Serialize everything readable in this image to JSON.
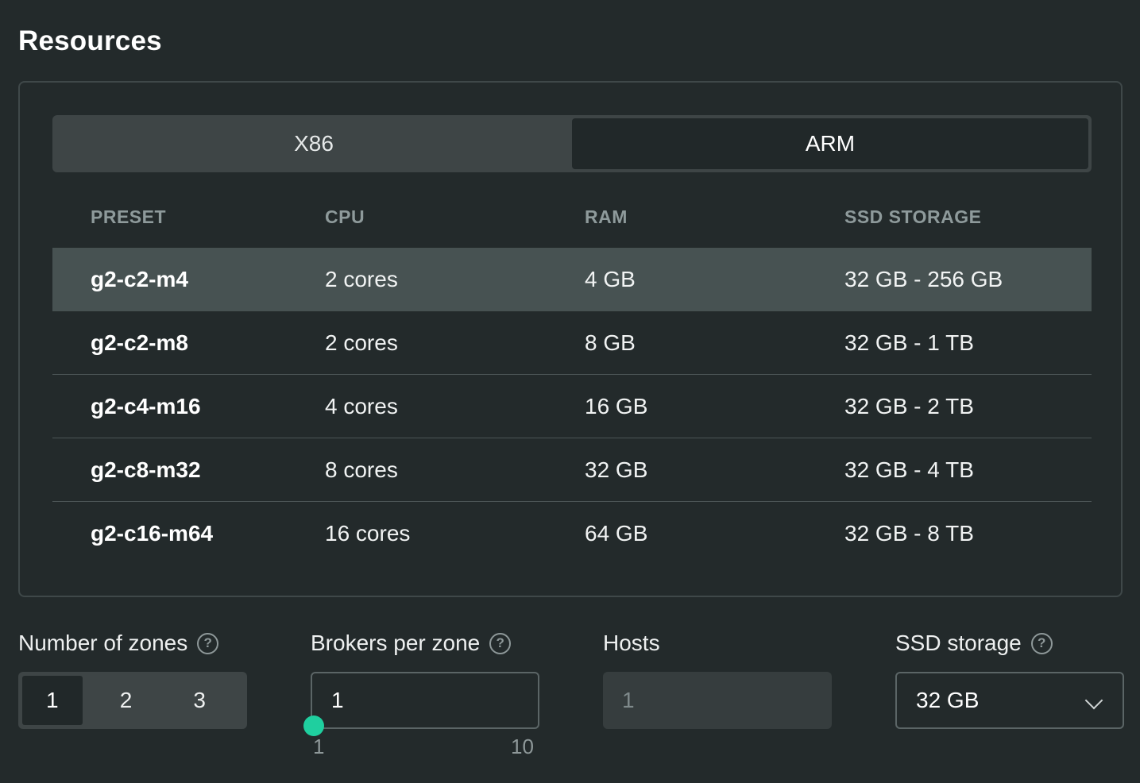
{
  "title": "Resources",
  "arch_tabs": [
    "X86",
    "ARM"
  ],
  "arch_selected": "ARM",
  "table": {
    "headers": [
      "PRESET",
      "CPU",
      "RAM",
      "SSD STORAGE"
    ],
    "rows": [
      [
        "g2-c2-m4",
        "2 cores",
        "4 GB",
        "32 GB - 256 GB"
      ],
      [
        "g2-c2-m8",
        "2 cores",
        "8 GB",
        "32 GB - 1 TB"
      ],
      [
        "g2-c4-m16",
        "4 cores",
        "16 GB",
        "32 GB - 2 TB"
      ],
      [
        "g2-c8-m32",
        "8 cores",
        "32 GB",
        "32 GB - 4 TB"
      ],
      [
        "g2-c16-m64",
        "16 cores",
        "64 GB",
        "32 GB - 8 TB"
      ]
    ],
    "selected_row": "g2-c2-m4"
  },
  "zones": {
    "label": "Number of zones",
    "help": "?",
    "options": [
      "1",
      "2",
      "3"
    ],
    "selected": "1"
  },
  "brokers": {
    "label": "Brokers per zone",
    "help": "?",
    "value": "1",
    "slider_min": "1",
    "slider_max": "10"
  },
  "hosts": {
    "label": "Hosts",
    "value": "1"
  },
  "ssd": {
    "label": "SSD storage",
    "help": "?",
    "value": "32 GB"
  },
  "colors": {
    "background": "#232a2b",
    "accent": "#1fcf9f",
    "selected_row": "#475252"
  },
  "icons": {
    "help": "question-circle-icon",
    "dropdown": "chevron-down-icon"
  }
}
